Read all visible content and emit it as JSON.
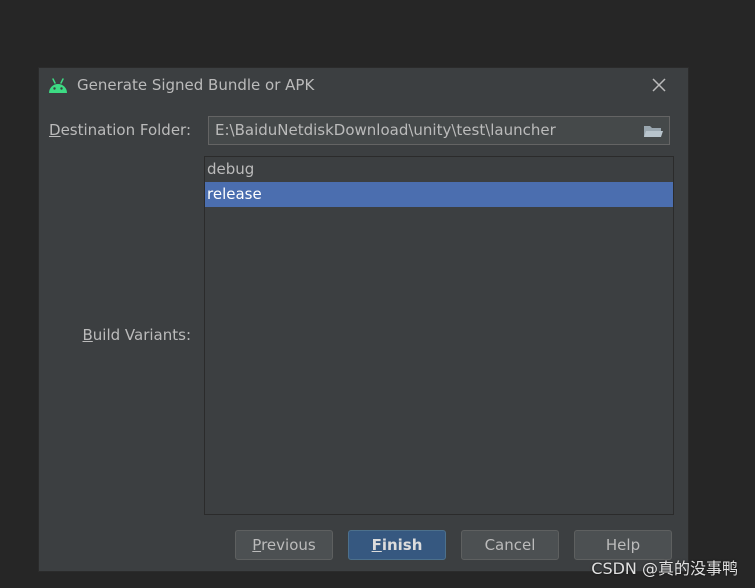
{
  "dialog": {
    "title": "Generate Signed Bundle or APK",
    "icon": "android-icon",
    "close_icon": "close-icon"
  },
  "destination": {
    "label_accel": "D",
    "label_rest": "estination Folder:",
    "value": "E:\\BaiduNetdiskDownload\\unity\\test\\launcher",
    "icon": "folder-icon"
  },
  "build_variants": {
    "label_accel": "B",
    "label_rest": "uild Variants:",
    "items": [
      {
        "label": "debug",
        "selected": false
      },
      {
        "label": "release",
        "selected": true
      }
    ]
  },
  "buttons": {
    "previous_accel": "P",
    "previous_rest": "revious",
    "finish_accel": "F",
    "finish_rest": "inish",
    "cancel": "Cancel",
    "help": "Help"
  },
  "watermark": "CSDN @真的没事鸭",
  "colors": {
    "background": "#262626",
    "dialog": "#3c3f41",
    "selection": "#4b6eaf",
    "primary_button": "#365880",
    "android_green": "#3ddc84"
  }
}
